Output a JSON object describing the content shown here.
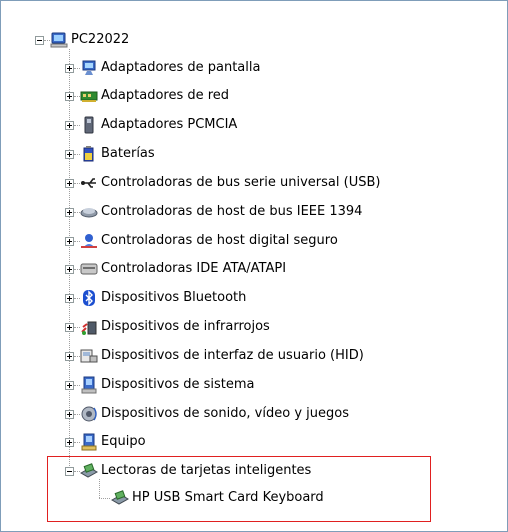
{
  "tree": {
    "root": {
      "label": "PC22022",
      "icon": "computer-icon"
    },
    "categories": [
      {
        "label": "Adaptadores de pantalla",
        "icon": "display-adapter-icon"
      },
      {
        "label": "Adaptadores de red",
        "icon": "network-adapter-icon"
      },
      {
        "label": "Adaptadores PCMCIA",
        "icon": "pcmcia-icon"
      },
      {
        "label": "Baterías",
        "icon": "battery-icon"
      },
      {
        "label": "Controladoras de bus serie universal (USB)",
        "icon": "usb-icon"
      },
      {
        "label": "Controladoras de host de bus IEEE 1394",
        "icon": "ieee1394-icon"
      },
      {
        "label": "Controladoras de host digital seguro",
        "icon": "sd-host-icon"
      },
      {
        "label": "Controladoras IDE ATA/ATAPI",
        "icon": "ide-controller-icon"
      },
      {
        "label": "Dispositivos Bluetooth",
        "icon": "bluetooth-icon"
      },
      {
        "label": "Dispositivos de infrarrojos",
        "icon": "infrared-icon"
      },
      {
        "label": "Dispositivos de interfaz de usuario (HID)",
        "icon": "hid-icon"
      },
      {
        "label": "Dispositivos de sistema",
        "icon": "system-device-icon"
      },
      {
        "label": "Dispositivos de sonido, vídeo y juegos",
        "icon": "sound-icon"
      },
      {
        "label": "Equipo",
        "icon": "computer-small-icon"
      },
      {
        "label": "Lectoras de tarjetas inteligentes",
        "icon": "smartcard-reader-icon",
        "expanded": true
      }
    ],
    "child": {
      "label": "HP USB Smart Card Keyboard",
      "icon": "smartcard-reader-icon"
    },
    "highlight_color": "#e02020"
  }
}
